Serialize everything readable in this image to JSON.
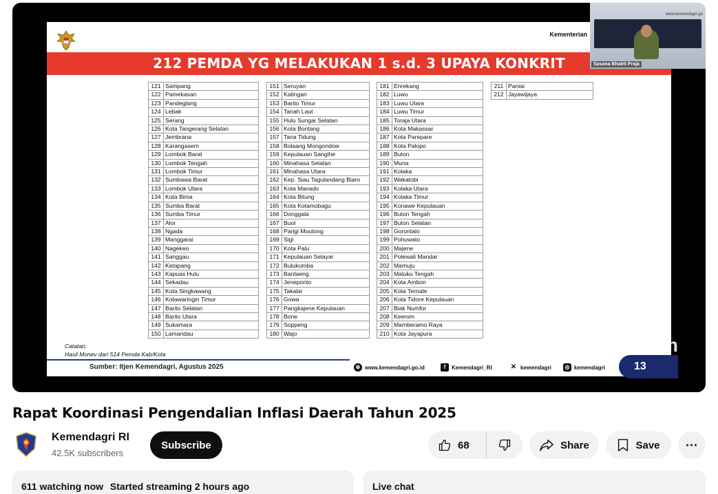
{
  "video": {
    "slide": {
      "organization": "Kementerian",
      "banner_title": "212 PEMDA YG MELAKUKAN 1 s.d. 3 UPAYA KONKRIT",
      "columns": [
        [
          [
            "121",
            "Sampang"
          ],
          [
            "122",
            "Pamekasan"
          ],
          [
            "123",
            "Pandeglang"
          ],
          [
            "124",
            "Lebak"
          ],
          [
            "125",
            "Serang"
          ],
          [
            "126",
            "Kota Tangerang Selatan"
          ],
          [
            "127",
            "Jembrana"
          ],
          [
            "128",
            "Karangasem"
          ],
          [
            "129",
            "Lombok Barat"
          ],
          [
            "130",
            "Lombok Tengah"
          ],
          [
            "131",
            "Lombok Timur"
          ],
          [
            "132",
            "Sumbawa Barat"
          ],
          [
            "133",
            "Lombok Utara"
          ],
          [
            "134",
            "Kota Bima"
          ],
          [
            "135",
            "Sumba Barat"
          ],
          [
            "136",
            "Sumba Timur"
          ],
          [
            "137",
            "Alor"
          ],
          [
            "138",
            "Ngada"
          ],
          [
            "139",
            "Manggarai"
          ],
          [
            "140",
            "Nagekeo"
          ],
          [
            "141",
            "Sanggau"
          ],
          [
            "142",
            "Ketapang"
          ],
          [
            "143",
            "Kapuas Hulu"
          ],
          [
            "144",
            "Sekadau"
          ],
          [
            "145",
            "Kota Singkawang"
          ],
          [
            "146",
            "Kotawaringin Timur"
          ],
          [
            "147",
            "Barito Selatan"
          ],
          [
            "148",
            "Barito Utara"
          ],
          [
            "149",
            "Sukamara"
          ],
          [
            "150",
            "Lamandau"
          ]
        ],
        [
          [
            "151",
            "Seruyan"
          ],
          [
            "152",
            "Katingan"
          ],
          [
            "153",
            "Barito Timur"
          ],
          [
            "154",
            "Tanah Laut"
          ],
          [
            "155",
            "Hulu Sungai Selatan"
          ],
          [
            "156",
            "Kota Bontang"
          ],
          [
            "157",
            "Tana Tidung"
          ],
          [
            "158",
            "Bolaang Mongondow"
          ],
          [
            "159",
            "Kepulauan Sangihe"
          ],
          [
            "160",
            "Minahasa Selatan"
          ],
          [
            "161",
            "Minahasa Utara"
          ],
          [
            "162",
            "Kep. Siau Tagulandang Biaro"
          ],
          [
            "163",
            "Kota Manado"
          ],
          [
            "164",
            "Kota Bitung"
          ],
          [
            "165",
            "Kota Kotamobagu"
          ],
          [
            "166",
            "Donggala"
          ],
          [
            "167",
            "Buol"
          ],
          [
            "168",
            "Parigi Moutong"
          ],
          [
            "169",
            "Sigi"
          ],
          [
            "170",
            "Kota Palu"
          ],
          [
            "171",
            "Kepulauan Selayar"
          ],
          [
            "172",
            "Bulukumba"
          ],
          [
            "173",
            "Bantaeng"
          ],
          [
            "174",
            "Jeneponto"
          ],
          [
            "175",
            "Takalar"
          ],
          [
            "176",
            "Gowa"
          ],
          [
            "177",
            "Pangkajene Kepulauan"
          ],
          [
            "178",
            "Bone"
          ],
          [
            "179",
            "Soppeng"
          ],
          [
            "180",
            "Wajo"
          ]
        ],
        [
          [
            "181",
            "Enrekang"
          ],
          [
            "182",
            "Luwu"
          ],
          [
            "183",
            "Luwu Utara"
          ],
          [
            "184",
            "Luwu Timur"
          ],
          [
            "185",
            "Toraja Utara"
          ],
          [
            "186",
            "Kota Makassar"
          ],
          [
            "187",
            "Kota Parepare"
          ],
          [
            "188",
            "Kota Palopo"
          ],
          [
            "189",
            "Buton"
          ],
          [
            "190",
            "Muna"
          ],
          [
            "191",
            "Kolaka"
          ],
          [
            "192",
            "Wakatobi"
          ],
          [
            "193",
            "Kolaka Utara"
          ],
          [
            "194",
            "Kolaka Timur"
          ],
          [
            "195",
            "Konawe Kepulauan"
          ],
          [
            "196",
            "Buton Tengah"
          ],
          [
            "197",
            "Buton Selatan"
          ],
          [
            "198",
            "Gorontalo"
          ],
          [
            "199",
            "Pohuwato"
          ],
          [
            "200",
            "Majene"
          ],
          [
            "201",
            "Polewali Mandar"
          ],
          [
            "202",
            "Mamuju"
          ],
          [
            "203",
            "Maluku Tengah"
          ],
          [
            "204",
            "Kota Ambon"
          ],
          [
            "205",
            "Kota Ternate"
          ],
          [
            "206",
            "Kota Tidore Kepulauan"
          ],
          [
            "207",
            "Biak Numfor"
          ],
          [
            "208",
            "Keerom"
          ],
          [
            "209",
            "Mamberamo Raya"
          ],
          [
            "210",
            "Kota Jayapura"
          ]
        ],
        [
          [
            "211",
            "Paniai"
          ],
          [
            "212",
            "Jayawijaya"
          ]
        ]
      ],
      "note_title": "Catatan:",
      "note_text": "Hasil Monev dari 514 Pemda Kab/Kota",
      "source": "Sumber: Itjen Kemendagri, Agustus 2025",
      "website": "www.kemendagri.go.id",
      "facebook": "Kemendagri_RI",
      "twitter": "kemendagri",
      "instagram": "kemendagri",
      "page_number": "13",
      "watermark": "om"
    },
    "pip": {
      "label": "Sasana Bhakti Praja",
      "url": "www.kemendagri.go"
    }
  },
  "video_title": "Rapat Koordinasi Pengendalian Inflasi Daerah Tahun 2025",
  "channel": {
    "name": "Kemendagri RI",
    "subscribers": "42.5K subscribers",
    "subscribe_label": "Subscribe"
  },
  "actions": {
    "likes": "68",
    "share_label": "Share",
    "save_label": "Save",
    "more_label": "⋯"
  },
  "info": {
    "watching": "611 watching now",
    "started": "Started streaming 2 hours ago"
  },
  "chat": {
    "label": "Live chat"
  },
  "colors": {
    "banner_red": "#e53a2c",
    "badge_navy": "#1a2a6c",
    "subscribe_black": "#0f0f0f"
  }
}
